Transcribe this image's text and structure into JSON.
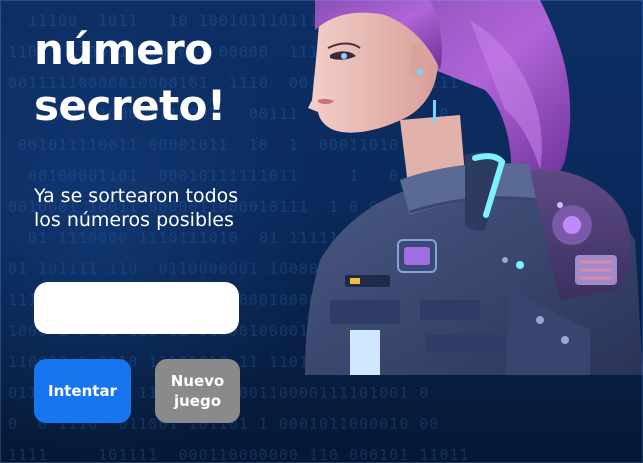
{
  "game": {
    "title": "número secreto!",
    "message": "Ya se sortearon todos los números posibles",
    "input_value": "",
    "input_placeholder": ""
  },
  "buttons": {
    "try_label": "Intentar",
    "new_game_label": "Nuevo juego"
  },
  "colors": {
    "background": "#0b2a5c",
    "primary_button": "#1875f0",
    "secondary_button": "#8a8a8a",
    "text": "#ffffff"
  },
  "illustration": {
    "icon": "astronaut-girl-illustration"
  }
}
